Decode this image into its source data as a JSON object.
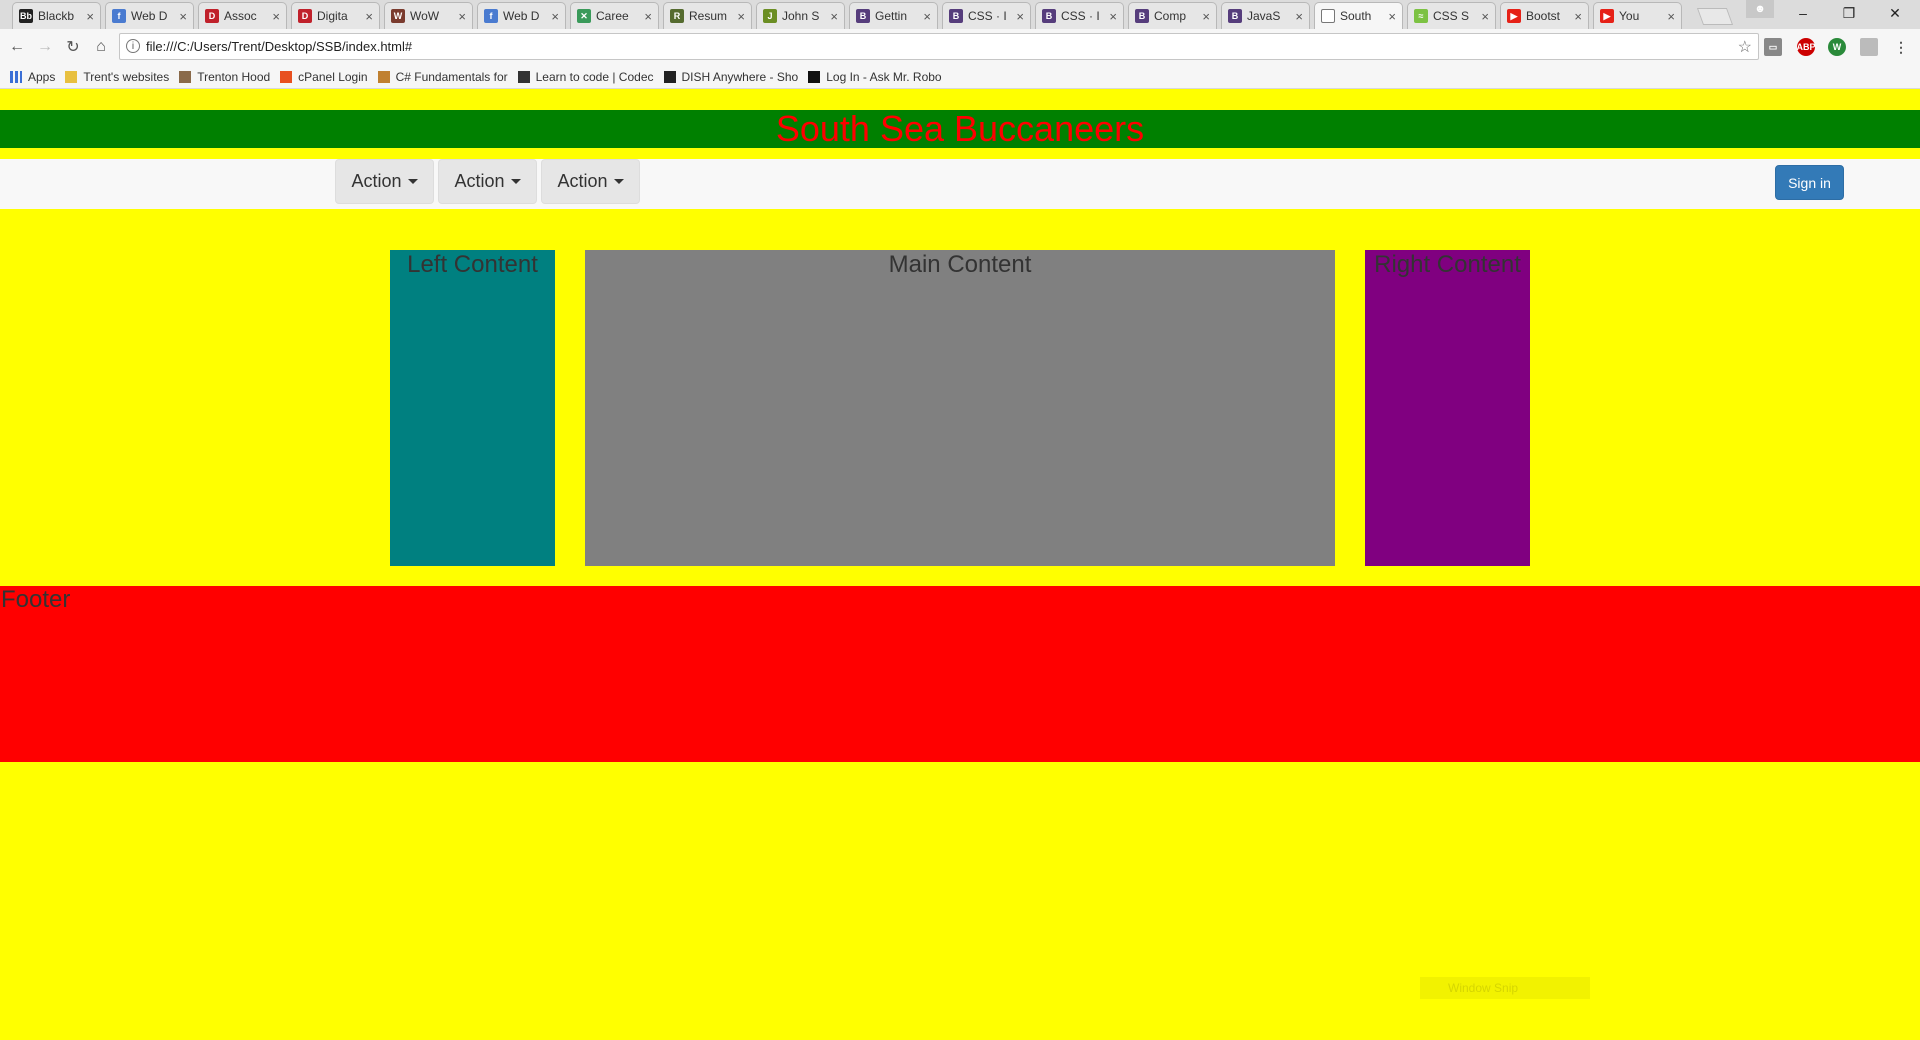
{
  "browser": {
    "tabs": [
      {
        "title": "Blackb",
        "icon": "blackboard-icon",
        "color": "#222222",
        "glyph": "Bb",
        "active": false
      },
      {
        "title": "Web D",
        "icon": "facebook-icon",
        "color": "#4a7bd0",
        "glyph": "f",
        "active": false
      },
      {
        "title": "Assoc",
        "icon": "assoc-icon",
        "color": "#c0212b",
        "glyph": "D",
        "active": false
      },
      {
        "title": "Digita",
        "icon": "digital-icon",
        "color": "#c0212b",
        "glyph": "D",
        "active": false
      },
      {
        "title": "WoW",
        "icon": "wow-icon",
        "color": "#7a3b2e",
        "glyph": "W",
        "active": false
      },
      {
        "title": "Web D",
        "icon": "facebook-icon",
        "color": "#4a7bd0",
        "glyph": "f",
        "active": false
      },
      {
        "title": "Caree",
        "icon": "career-icon",
        "color": "#3a9a5a",
        "glyph": "✕",
        "active": false
      },
      {
        "title": "Resum",
        "icon": "resume-icon",
        "color": "#556b2f",
        "glyph": "R",
        "active": false
      },
      {
        "title": "John S",
        "icon": "john-icon",
        "color": "#6b8e23",
        "glyph": "J",
        "active": false
      },
      {
        "title": "Gettin",
        "icon": "bootstrap-icon",
        "color": "#563d7c",
        "glyph": "B",
        "active": false
      },
      {
        "title": "CSS · I",
        "icon": "bootstrap-icon",
        "color": "#563d7c",
        "glyph": "B",
        "active": false
      },
      {
        "title": "CSS · I",
        "icon": "bootstrap-icon",
        "color": "#563d7c",
        "glyph": "B",
        "active": false
      },
      {
        "title": "Comp",
        "icon": "bootstrap-icon",
        "color": "#563d7c",
        "glyph": "B",
        "active": false
      },
      {
        "title": "JavaS",
        "icon": "bootstrap-icon",
        "color": "#563d7c",
        "glyph": "B",
        "active": false
      },
      {
        "title": "South",
        "icon": "page-icon",
        "color": "#ffffff",
        "glyph": "",
        "active": true
      },
      {
        "title": "CSS S",
        "icon": "css-icon",
        "color": "#7cc242",
        "glyph": "≈",
        "active": false
      },
      {
        "title": "Bootst",
        "icon": "youtube-icon",
        "color": "#e62117",
        "glyph": "▶",
        "active": false
      },
      {
        "title": "You",
        "icon": "youtube-icon",
        "color": "#e62117",
        "glyph": "▶",
        "active": false
      }
    ],
    "url": "file:///C:/Users/Trent/Desktop/SSB/index.html#",
    "bookmarks": [
      {
        "label": "Apps",
        "icon": "apps-grid-icon"
      },
      {
        "label": "Trent's websites",
        "icon": "folder-icon"
      },
      {
        "label": "Trenton Hood",
        "icon": "avatar-icon"
      },
      {
        "label": "cPanel Login",
        "icon": "cpanel-icon"
      },
      {
        "label": "C# Fundamentals for",
        "icon": "csharp-icon"
      },
      {
        "label": "Learn to code | Codec",
        "icon": "codecademy-icon"
      },
      {
        "label": "DISH Anywhere - Sho",
        "icon": "dish-icon"
      },
      {
        "label": "Log In - Ask Mr. Robo",
        "icon": "mrrobot-icon"
      }
    ]
  },
  "page": {
    "title": "South Sea Buccaneers",
    "nav": {
      "dropdowns": [
        "Action",
        "Action",
        "Action"
      ],
      "signin_label": "Sign in"
    },
    "columns": {
      "left": "Left Content",
      "main": "Main Content",
      "right": "Right Content"
    },
    "footer": "Footer",
    "colors": {
      "background": "#ffff00",
      "header": "#008000",
      "title_text": "#ff0000",
      "left": "#008080",
      "main": "#808080",
      "right": "#800080",
      "footer": "#ff0000",
      "signin": "#337ab7"
    }
  },
  "overlay": {
    "snip_label": "Window Snip"
  }
}
